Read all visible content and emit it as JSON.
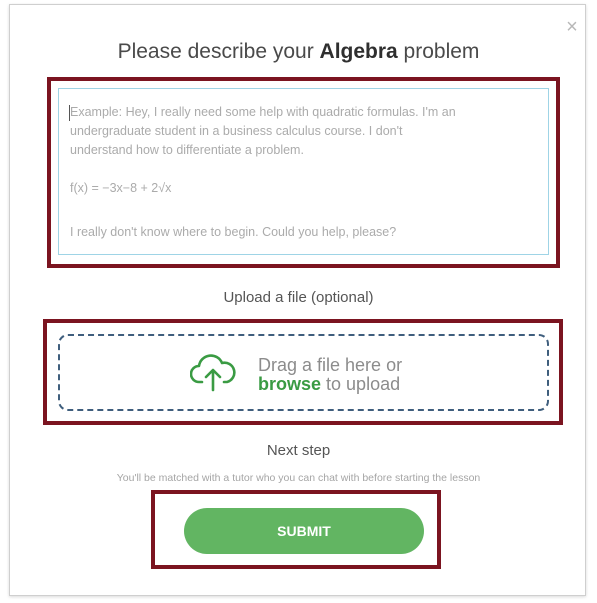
{
  "modal": {
    "close_glyph": "×",
    "title_prefix": "Please describe your ",
    "title_subject": "Algebra",
    "title_suffix": " problem"
  },
  "description": {
    "placeholder_lines": [
      "Example: Hey, I really need some help with quadratic formulas. I'm an",
      "undergraduate student in a business calculus course. I don't",
      "understand how to differentiate a problem.",
      "f(x) = −3x−8 + 2√x",
      "I really don't know where to begin. Could you help, please?"
    ]
  },
  "upload": {
    "label": "Upload a file (optional)",
    "drop_text": "Drag a file here or",
    "browse_link": "browse",
    "drop_suffix": " to upload",
    "icon": "cloud-upload-icon",
    "icon_color": "#3a9b43"
  },
  "next": {
    "heading": "Next step",
    "description": "You'll be matched with a tutor who you can chat with before starting the lesson"
  },
  "submit": {
    "label": "SUBMIT",
    "color": "#62b562"
  },
  "colors": {
    "highlight_border": "#7b1420",
    "dropzone_border": "#3f5e7d",
    "textarea_border": "#9fd4e6"
  }
}
